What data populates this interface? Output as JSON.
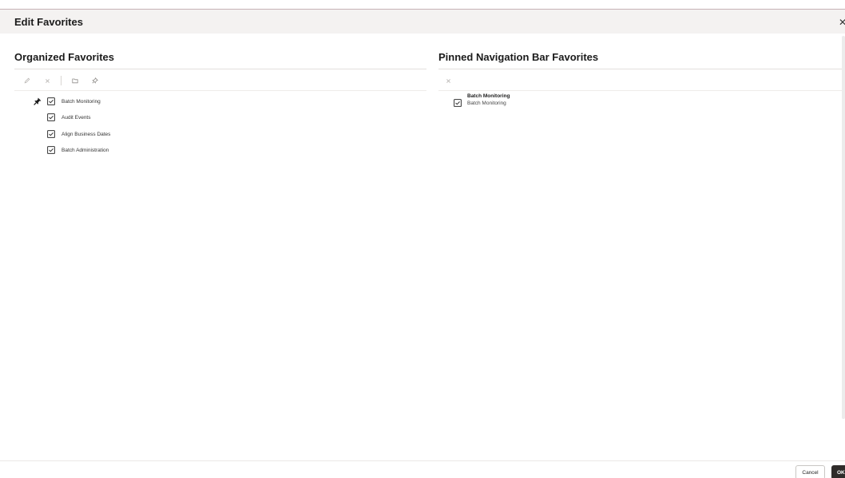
{
  "dialog": {
    "title": "Edit Favorites",
    "close_icon": "close-icon"
  },
  "organized": {
    "title": "Organized Favorites",
    "toolbar": [
      {
        "name": "edit-button",
        "icon": "pencil-icon",
        "enabled": false
      },
      {
        "name": "remove-button",
        "icon": "close-icon",
        "enabled": false
      },
      {
        "name": "new-folder-button",
        "icon": "folder-icon",
        "enabled": false
      },
      {
        "name": "pin-button",
        "icon": "pin-icon",
        "enabled": false
      }
    ],
    "items": [
      {
        "label": "Batch Monitoring",
        "pinned": true
      },
      {
        "label": "Audit Events",
        "pinned": false
      },
      {
        "label": "Align Business Dates",
        "pinned": false
      },
      {
        "label": "Batch Administration",
        "pinned": false
      }
    ]
  },
  "pinned": {
    "title": "Pinned Navigation Bar Favorites",
    "toolbar": [
      {
        "name": "unpin-remove-button",
        "icon": "close-icon",
        "enabled": false
      }
    ],
    "items": [
      {
        "primary": "Batch Monitoring",
        "secondary": "Batch Monitoring"
      }
    ]
  },
  "footer": {
    "cancel_label": "Cancel",
    "ok_label": "OK"
  },
  "colors": {
    "title_bar": "#f4f2f1",
    "primary_button": "#2f2c2a",
    "disabled_icon": "#b8b5b2"
  }
}
